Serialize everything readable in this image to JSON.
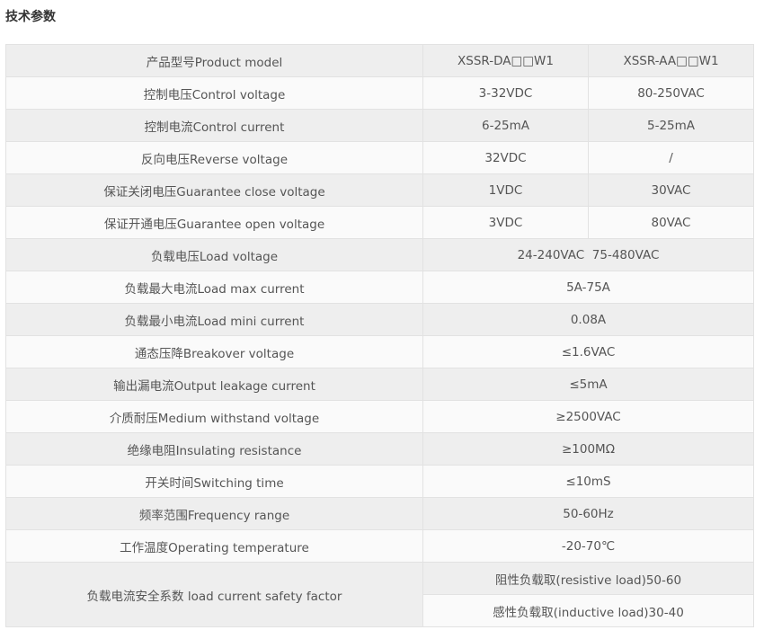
{
  "section_title": "技术参数",
  "columns": [
    "XSSR-DA□□W1",
    "XSSR-AA□□W1"
  ],
  "header_label": "产品型号Product model",
  "split_rows": [
    {
      "label": "控制电压Control voltage",
      "values": [
        "3-32VDC",
        "80-250VAC"
      ]
    },
    {
      "label": "控制电流Control current",
      "values": [
        "6-25mA",
        "5-25mA"
      ]
    },
    {
      "label": "反向电压Reverse voltage",
      "values": [
        "32VDC",
        "/"
      ]
    },
    {
      "label": "保证关闭电压Guarantee close voltage",
      "values": [
        "1VDC",
        "30VAC"
      ]
    },
    {
      "label": "保证开通电压Guarantee open voltage",
      "values": [
        "3VDC",
        "80VAC"
      ]
    }
  ],
  "merged_rows": [
    {
      "label": "负载电压Load voltage",
      "value": "24-240VAC  75-480VAC"
    },
    {
      "label": "负载最大电流Load max current",
      "value": "5A-75A"
    },
    {
      "label": "负载最小电流Load mini current",
      "value": "0.08A"
    },
    {
      "label": "通态压降Breakover voltage",
      "value": "≤1.6VAC"
    },
    {
      "label": "输出漏电流Output leakage current",
      "value": "≤5mA"
    },
    {
      "label": "介质耐压Medium withstand voltage",
      "value": "≥2500VAC"
    },
    {
      "label": "绝缘电阻Insulating resistance",
      "value": "≥100MΩ"
    },
    {
      "label": "开关时间Switching time",
      "value": "≤10mS"
    },
    {
      "label": "频率范围Frequency range",
      "value": "50-60Hz"
    },
    {
      "label": "工作温度Operating temperature",
      "value": "-20-70℃"
    }
  ],
  "safety": {
    "label": "负载电流安全系数 load current safety factor",
    "values": [
      "阻性负载取(resistive load)50-60",
      "感性负载取(inductive load)30-40"
    ]
  }
}
